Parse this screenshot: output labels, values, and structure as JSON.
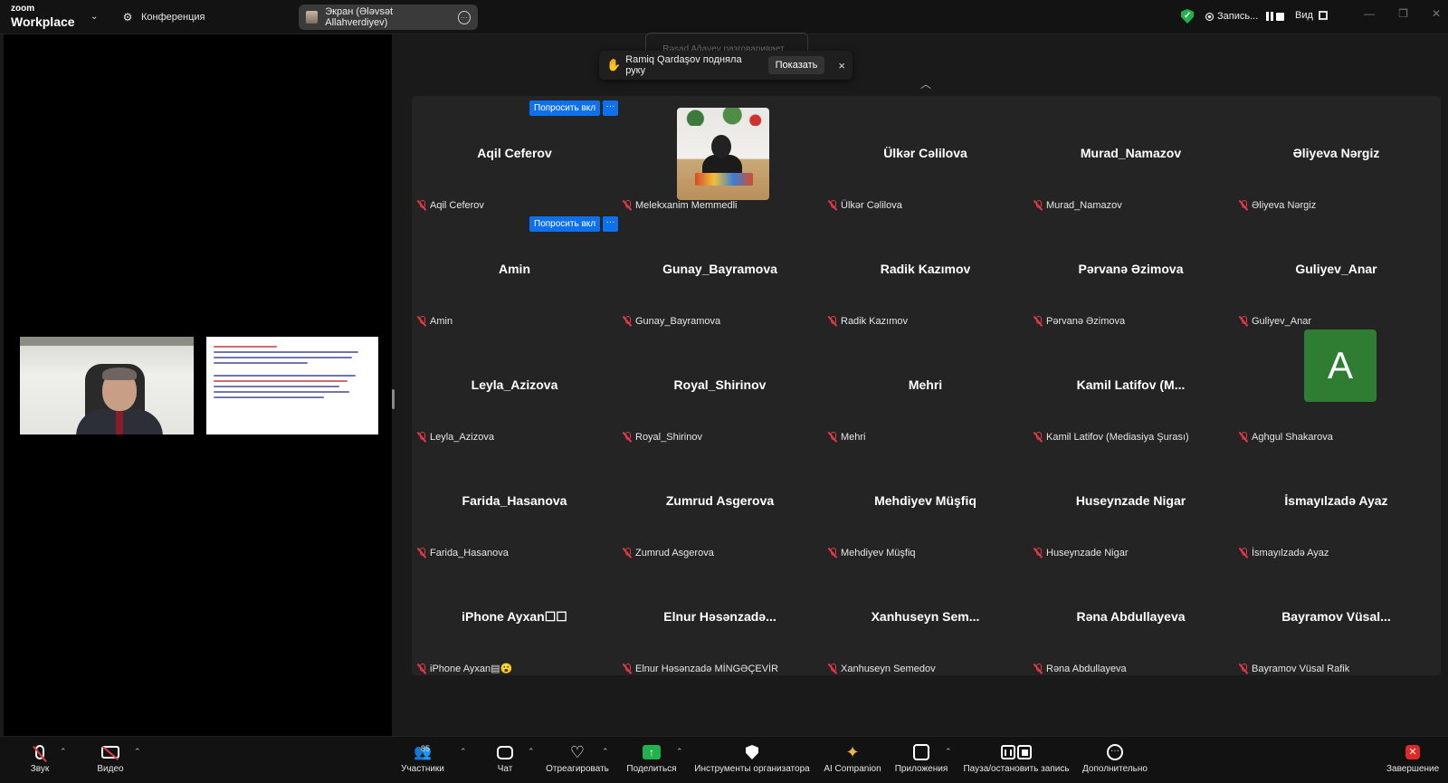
{
  "app": {
    "brand": "zoom",
    "product": "Workplace",
    "meeting_label": "Конференция",
    "screen_tab": "Экран (Ələvsət Allahverdiyev)"
  },
  "status": {
    "record_label": "Запись...",
    "view_label": "Вид"
  },
  "overlay": {
    "ghost_tab": "Rəşad Ağayev разговаривает...",
    "notification_text": "Ramiq Qardaşov подняла руку",
    "show_button": "Показать",
    "close": "×"
  },
  "gallery": {
    "ask_button": "Попросить вкл",
    "ask_more": "···",
    "tiles": [
      {
        "display": "Aqil Ceferov",
        "name": "Aqil Ceferov"
      },
      {
        "display": "",
        "name": "Melekxanim Memmedli",
        "video": true
      },
      {
        "display": "Ülkər Cəlilova",
        "name": "Ülkər Cəlilova"
      },
      {
        "display": "Murad_Namazov",
        "name": "Murad_Namazov"
      },
      {
        "display": "Əliyeva Nərgiz",
        "name": "Əliyeva Nərgiz"
      },
      {
        "display": "Amin",
        "name": "Amin"
      },
      {
        "display": "Gunay_Bayramova",
        "name": "Gunay_Bayramova"
      },
      {
        "display": "Radik Kazımov",
        "name": "Radik Kazımov"
      },
      {
        "display": "Pərvanə Əzimova",
        "name": "Pərvanə Əzimova"
      },
      {
        "display": "Guliyev_Anar",
        "name": "Guliyev_Anar"
      },
      {
        "display": "Leyla_Azizova",
        "name": "Leyla_Azizova"
      },
      {
        "display": "Royal_Shirinov",
        "name": "Royal_Shirinov"
      },
      {
        "display": "Mehri",
        "name": "Mehri"
      },
      {
        "display": "Kamil Latifov (M...",
        "name": "Kamil Latifov (Mediasiya Şurası)"
      },
      {
        "display": "",
        "name": "Aghgul Shakarova",
        "avatar": "A",
        "avatar_color": "#2f7d32"
      },
      {
        "display": "Farida_Hasanova",
        "name": "Farida_Hasanova"
      },
      {
        "display": "Zumrud Asgerova",
        "name": "Zumrud Asgerova"
      },
      {
        "display": "Mehdiyev Müşfiq",
        "name": "Mehdiyev Müşfiq"
      },
      {
        "display": "Huseynzade Nigar",
        "name": "Huseynzade Nigar"
      },
      {
        "display": "İsmayılzadə Ayaz",
        "name": "İsmayılzadə Ayaz"
      },
      {
        "display": "iPhone Ayxan☐☐",
        "name": "iPhone Ayxan▤😮"
      },
      {
        "display": "Elnur Həsənzadə...",
        "name": "Elnur Həsənzadə MİNGƏÇEVİR"
      },
      {
        "display": "Xanhuseyn Sem...",
        "name": "Xanhuseyn Semedov"
      },
      {
        "display": "Rəna Abdullayeva",
        "name": "Rəna Abdullayeva"
      },
      {
        "display": "Bayramov Vüsal...",
        "name": "Bayramov Vüsal Rafik"
      }
    ]
  },
  "toolbar": {
    "audio": "Звук",
    "video": "Видео",
    "participants": "Участники",
    "participants_count": "85",
    "chat": "Чат",
    "react": "Отреагировать",
    "share": "Поделиться",
    "host_tools": "Инструменты организатора",
    "ai": "AI Companion",
    "apps": "Приложения",
    "pause_record": "Пауза/остановить запись",
    "more": "Дополнительно",
    "end": "Завершение"
  },
  "colors": {
    "accent_blue": "#0e71eb",
    "share_green": "#22b14c",
    "muted_red": "#e63946",
    "end_red": "#e02828"
  }
}
